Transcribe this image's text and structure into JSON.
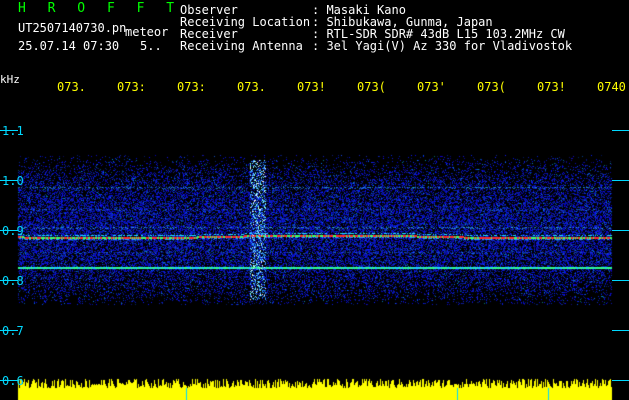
{
  "header": {
    "title": "H R O F F T",
    "filename": "UT2507140730.pn",
    "tag": "meteor",
    "datetime": "25.07.14 07:30",
    "count": "5.."
  },
  "info": {
    "observer_label": "Observer",
    "observer_value": ": Masaki Kano",
    "location_label": "Receiving Location",
    "location_value": ": Shibukawa, Gunma, Japan",
    "receiver_label": "Receiver",
    "receiver_value": ": RTL-SDR SDR# 43dB L15 103.2MHz CW",
    "antenna_label": "Receiving Antenna",
    "antenna_value": ": 3el Yagi(V) Az 330 for Vladivostok"
  },
  "axis": {
    "unit": "kHz",
    "time_ticks": [
      "073.",
      "073:",
      "073:",
      "073.",
      "073!",
      "073(",
      "073'",
      "073(",
      "073!",
      "0740"
    ],
    "freq_ticks": [
      "1.1",
      "1.0",
      "0.9",
      "0.8",
      "0.7",
      "0.6"
    ]
  },
  "colors": {
    "background": "#000000",
    "header_green": "#00ff00",
    "time_yellow": "#ffff00",
    "axis_cyan": "#00d8ff",
    "signal_red": "#ff2020"
  }
}
